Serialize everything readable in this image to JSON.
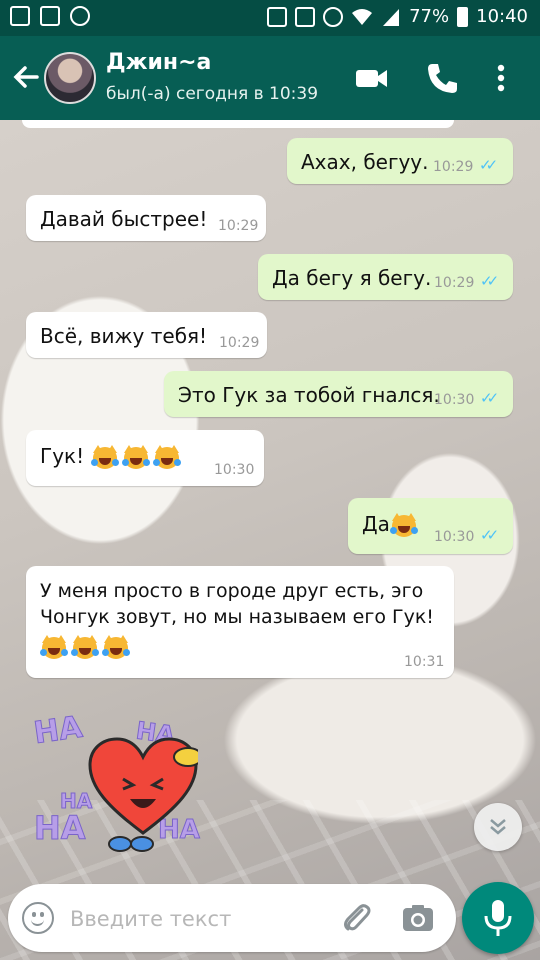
{
  "status_bar": {
    "battery": "77%",
    "time": "10:40",
    "icons": [
      "sim-icon",
      "image-icon",
      "whatsapp-icon",
      "cast-icon",
      "mute-icon",
      "alarm-icon",
      "wifi-icon",
      "signal-icon",
      "battery-icon"
    ]
  },
  "header": {
    "contact_name": "Джин~a",
    "last_seen": "был(-а) сегодня в 10:39"
  },
  "messages": [
    {
      "dir": "out",
      "text": "Ахах, бегуу.",
      "time": "10:29",
      "read": true
    },
    {
      "dir": "in",
      "text": "Давай быстрее!",
      "time": "10:29"
    },
    {
      "dir": "out",
      "text": "Да бегу я бегу.",
      "time": "10:29",
      "read": true
    },
    {
      "dir": "in",
      "text": "Всё, вижу тебя!",
      "time": "10:29"
    },
    {
      "dir": "out",
      "text": "Это Гук за тобой гнался.",
      "time": "10:30",
      "read": true
    },
    {
      "dir": "in",
      "text": "Гук!",
      "emoji": "joy-cat-emoji",
      "emoji_count": 3,
      "time": "10:30"
    },
    {
      "dir": "out",
      "text": "Да",
      "emoji": "joy-cat-emoji",
      "emoji_count": 1,
      "time": "10:30",
      "read": true
    },
    {
      "dir": "in",
      "lines": [
        "У меня просто в городе друг есть, эго",
        "Чонгук зовут, но мы называем его Гук!"
      ],
      "emoji": "joy-cat-emoji",
      "emoji_count": 3,
      "time": "10:31"
    }
  ],
  "sticker": {
    "texts": [
      "HA",
      "HA",
      "HA",
      "HA",
      "HA"
    ]
  },
  "composer": {
    "placeholder": "Введите текст"
  },
  "colors": {
    "appbar": "#075e54",
    "statusbar": "#054d44",
    "outgoing_bubble": "#e2f7cb",
    "incoming_bubble": "#ffffff",
    "read_ticks": "#4fc3f7",
    "mic_button": "#00897b"
  }
}
